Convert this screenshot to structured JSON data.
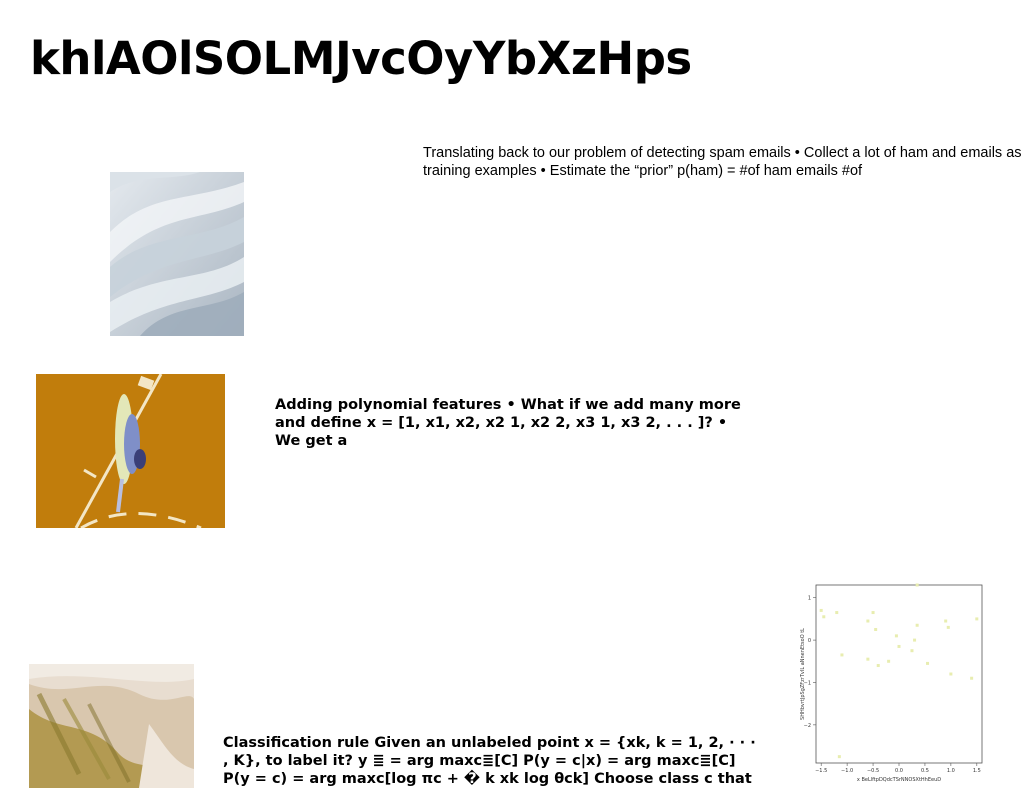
{
  "slide": {
    "title": "khlAOlSOLMJvcOyYbXzHps",
    "paragraphs": [
      "Translating back to our problem of detecting spam emails • Collect a lot of ham and emails as training examples • Estimate the “prior” p(ham) = #of ham emails #of",
      "Adding polynomial features • What if we add many more and define x = [1, x1, x2, x2 1, x2 2, x3 1, x3 2, . . . ]? • We get a",
      "Classification rule Given an unlabeled point x = {xk, k = 1, 2, · · · , K}, to label it? y ≣ = arg maxc≣[C] P(y = c|x) = arg maxc≣[C] P(y = c) = arg maxc[log πc + � k xk log θck] Choose class c that"
    ]
  },
  "chart_data": {
    "type": "scatter",
    "xlabel": "x BeLlftpDQdcTSrNNOSXtHhEeuD",
    "ylabel": "SHHbvrtJpSgZFzrTvIL aNnenEtsoO tL",
    "xlim": [
      -1.6,
      1.6
    ],
    "ylim": [
      -2.9,
      1.3
    ],
    "x_ticks": [
      "−1.5",
      "−1.0",
      "−0.5",
      "0.0",
      "0.5",
      "1.0",
      "1.5"
    ],
    "y_ticks": [
      "1",
      "0",
      "−1",
      "−2"
    ],
    "point_color": "#e8edb0",
    "points": [
      {
        "x": -1.5,
        "y": 0.7
      },
      {
        "x": -1.45,
        "y": 0.55
      },
      {
        "x": -1.2,
        "y": 0.65
      },
      {
        "x": -1.1,
        "y": -0.35
      },
      {
        "x": -1.15,
        "y": -2.75
      },
      {
        "x": -0.6,
        "y": 0.45
      },
      {
        "x": -0.5,
        "y": 0.65
      },
      {
        "x": -0.45,
        "y": 0.25
      },
      {
        "x": -0.4,
        "y": -0.6
      },
      {
        "x": -0.6,
        "y": -0.45
      },
      {
        "x": -0.2,
        "y": -0.5
      },
      {
        "x": -0.05,
        "y": 0.1
      },
      {
        "x": 0.0,
        "y": -0.15
      },
      {
        "x": 0.25,
        "y": -0.25
      },
      {
        "x": 0.3,
        "y": 0.0
      },
      {
        "x": 0.35,
        "y": 0.35
      },
      {
        "x": 0.35,
        "y": 1.3
      },
      {
        "x": 0.55,
        "y": -0.55
      },
      {
        "x": 0.9,
        "y": 0.45
      },
      {
        "x": 0.95,
        "y": 0.3
      },
      {
        "x": 1.0,
        "y": -0.8
      },
      {
        "x": 1.4,
        "y": -0.9
      },
      {
        "x": 1.5,
        "y": 0.5
      }
    ]
  }
}
